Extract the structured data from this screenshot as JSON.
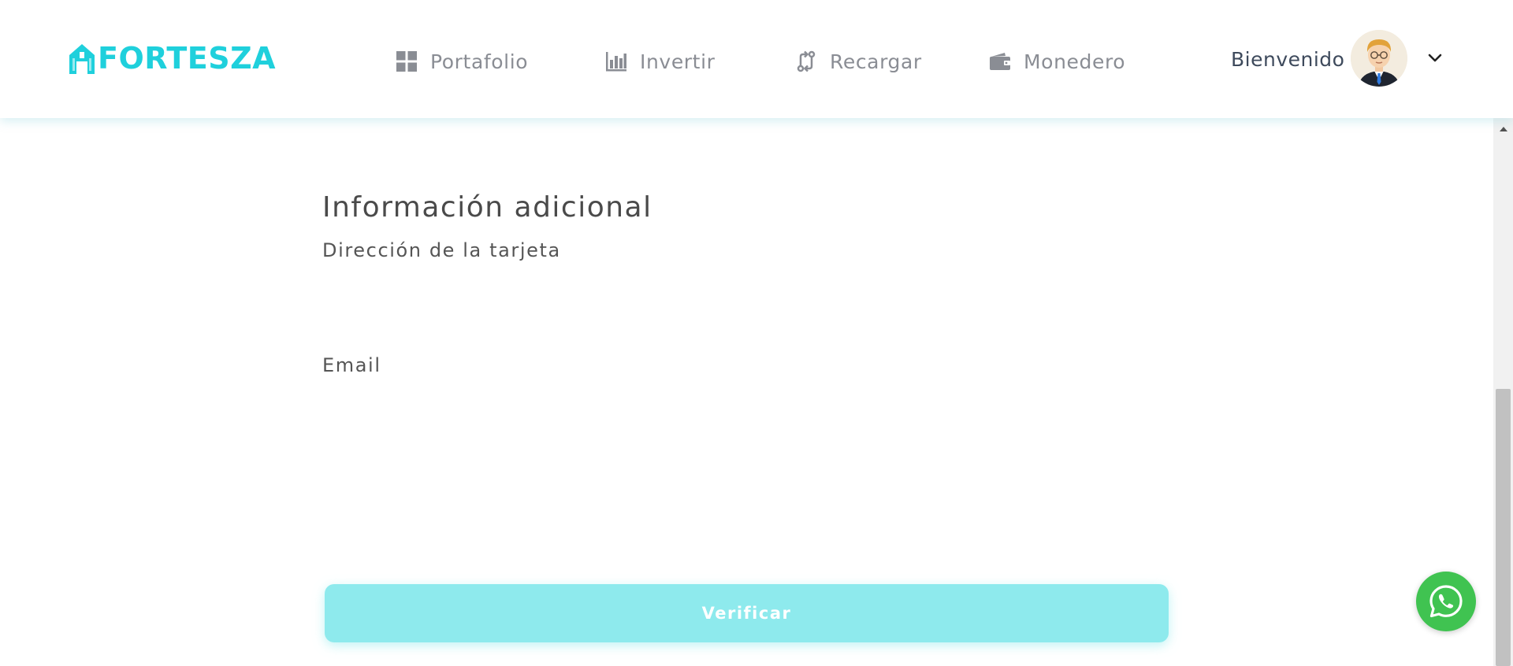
{
  "brand": {
    "name": "FORTESZA",
    "color": "#1fd0dc"
  },
  "nav": {
    "items": [
      {
        "label": "Portafolio",
        "icon": "grid-icon"
      },
      {
        "label": "Invertir",
        "icon": "bar-chart-icon"
      },
      {
        "label": "Recargar",
        "icon": "transfer-icon"
      },
      {
        "label": "Monedero",
        "icon": "wallet-icon"
      }
    ]
  },
  "user": {
    "greeting": "Bienvenido",
    "avatar_icon": "user-avatar",
    "menu_icon": "chevron-down-icon"
  },
  "form": {
    "section_title": "Información adicional",
    "fields": [
      {
        "label": "Dirección de la tarjeta",
        "value": "",
        "placeholder": ""
      },
      {
        "label": "Email",
        "value": "",
        "placeholder": ""
      }
    ],
    "submit_label": "Verificar"
  },
  "colors": {
    "accent": "#1fd0dc",
    "button": "#8eeaed",
    "whatsapp": "#40c351",
    "nav_text": "#8a8d94"
  },
  "floating": {
    "whatsapp_icon": "whatsapp-icon"
  }
}
